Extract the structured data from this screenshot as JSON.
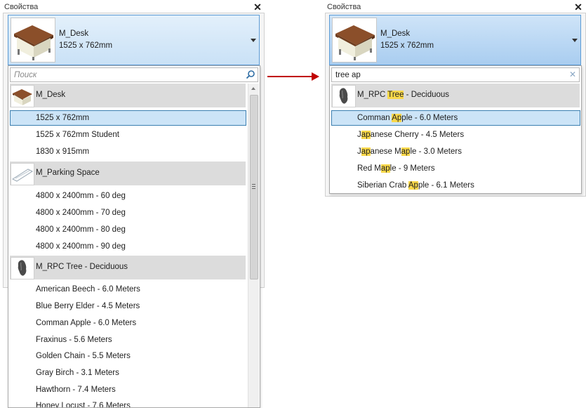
{
  "left": {
    "panel_title": "Свойства",
    "selected_family": "M_Desk",
    "selected_type": "1525 x 762mm",
    "search": {
      "placeholder": "Поиск",
      "value": ""
    },
    "families": [
      {
        "name": "M_Desk",
        "icon": "desk-thumbnail",
        "types": [
          "1525 x 762mm",
          "1525 x 762mm Student",
          "1830 x 915mm"
        ]
      },
      {
        "name": "M_Parking Space",
        "icon": "parking-space-thumbnail",
        "types": [
          "4800 x 2400mm - 60 deg",
          "4800 x 2400mm - 70 deg",
          "4800 x 2400mm - 80 deg",
          "4800 x 2400mm - 90 deg"
        ]
      },
      {
        "name": "M_RPC Tree - Deciduous",
        "icon": "tree-thumbnail",
        "types": [
          "American Beech - 6.0 Meters",
          "Blue Berry Elder - 4.5 Meters",
          "Comman Apple - 6.0 Meters",
          "Fraxinus - 5.6 Meters",
          "Golden Chain - 5.5 Meters",
          "Gray Birch - 3.1 Meters",
          "Hawthorn - 7.4 Meters",
          "Honey Locust - 7.6 Meters"
        ]
      }
    ]
  },
  "right": {
    "panel_title": "Свойства",
    "selected_family": "M_Desk",
    "selected_type": "1525 x 762mm",
    "search": {
      "placeholder": "Поиск",
      "value": "tree ap"
    },
    "family": {
      "pre": "M_RPC ",
      "hl": "Tree",
      "post": " - Deciduous",
      "icon": "tree-thumbnail"
    },
    "types": [
      {
        "pre": "Comman ",
        "hl": "Ap",
        "post": "ple - 6.0 Meters"
      },
      {
        "pre": "J",
        "hl": "ap",
        "post": "anese Cherry - 4.5 Meters"
      },
      {
        "pre": "J",
        "hl": "ap",
        "post": "anese M",
        "hl2": "ap",
        "post2": "le - 3.0 Meters"
      },
      {
        "pre": "Red M",
        "hl": "ap",
        "post": "le - 9 Meters"
      },
      {
        "pre": "Siberian Crab ",
        "hl": "Ap",
        "post": "ple - 6.1 Meters"
      }
    ]
  },
  "colors": {
    "accent": "#3c7fb1",
    "selected_row": "#cce4f7",
    "highlight": "#f9d84a",
    "arrow": "#c00000",
    "family_row": "#dcdcdc"
  },
  "icons": {
    "close": "close-icon",
    "search": "search-icon",
    "clear": "clear-icon",
    "dropdown": "chevron-down-icon"
  }
}
